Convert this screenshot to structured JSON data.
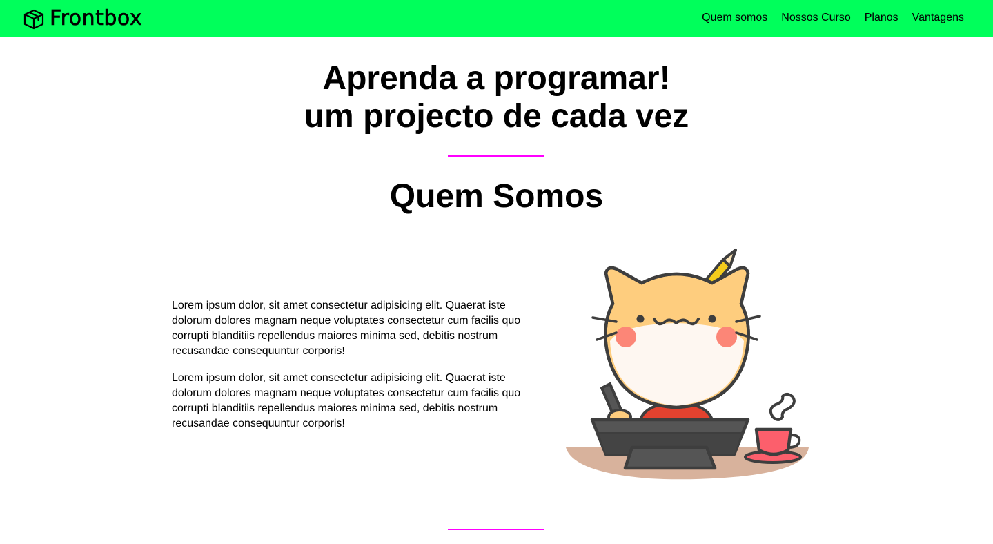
{
  "header": {
    "brand": "Frontbox",
    "brand_icon": "box-icon",
    "nav": [
      {
        "label": "Quem somos"
      },
      {
        "label": "Nossos Curso"
      },
      {
        "label": "Planos"
      },
      {
        "label": "Vantagens"
      }
    ],
    "background_color": "#00ff5b"
  },
  "hero": {
    "line1": "Aprenda a programar!",
    "line2": "um projecto de cada vez"
  },
  "about": {
    "title": "Quem Somos",
    "paragraphs": [
      "Lorem ipsum dolor, sit amet consectetur adipisicing elit. Quaerat iste dolorum dolores magnam neque voluptates consectetur cum facilis quo corrupti blanditiis repellendus maiores minima sed, debitis nostrum recusandae consequuntur corporis!",
      "Lorem ipsum dolor, sit amet consectetur adipisicing elit. Quaerat iste dolorum dolores magnam neque voluptates consectetur cum facilis quo corrupti blanditiis repellendus maiores minima sed, debitis nostrum recusandae consequuntur corporis!"
    ],
    "illustration": "cat-coding-illustration"
  },
  "colors": {
    "accent": "#ff00ff",
    "nav_bg": "#00ff5b"
  }
}
